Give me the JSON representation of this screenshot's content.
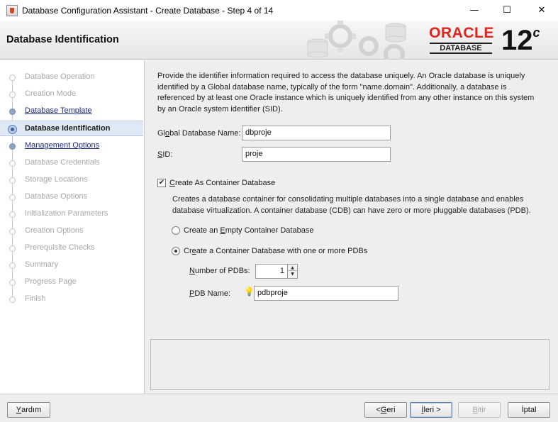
{
  "window": {
    "title": "Database Configuration Assistant - Create Database - Step 4 of 14",
    "controls": {
      "minimize": "—",
      "maximize": "☐",
      "close": "✕"
    }
  },
  "header": {
    "title": "Database Identification",
    "logo": {
      "word": "ORACLE",
      "registered": "®",
      "sub": "DATABASE",
      "version": "12",
      "version_suffix": "c"
    }
  },
  "nav": {
    "items": [
      {
        "label": "Database Operation",
        "state": "disabled"
      },
      {
        "label": "Creation Mode",
        "state": "disabled"
      },
      {
        "label": "Database Template",
        "state": "link"
      },
      {
        "label": "Database Identification",
        "state": "current"
      },
      {
        "label": "Management Options",
        "state": "link"
      },
      {
        "label": "Database Credentials",
        "state": "disabled"
      },
      {
        "label": "Storage Locations",
        "state": "disabled"
      },
      {
        "label": "Database Options",
        "state": "disabled"
      },
      {
        "label": "Initialization Parameters",
        "state": "disabled"
      },
      {
        "label": "Creation Options",
        "state": "disabled"
      },
      {
        "label": "Prerequisite Checks",
        "state": "disabled"
      },
      {
        "label": "Summary",
        "state": "disabled"
      },
      {
        "label": "Progress Page",
        "state": "disabled"
      },
      {
        "label": "Finish",
        "state": "disabled"
      }
    ]
  },
  "form": {
    "description": "Provide the identifier information required to access the database uniquely. An Oracle database is uniquely identified by a Global database name, typically of the form \"name.domain\". Additionally, a database is referenced by at least one Oracle instance which is uniquely identified from any other instance on this system by an Oracle system identifier (SID).",
    "global_db_name": {
      "label_pre": "Gl",
      "label_key": "o",
      "label_post": "bal Database Name:",
      "value": "dbproje"
    },
    "sid": {
      "label_key": "S",
      "label_post": "ID:",
      "value": "proje"
    },
    "container": {
      "checked": true,
      "label_key": "C",
      "label_post": "reate As Container Database",
      "description": "Creates a database container for consolidating multiple databases into a single database and enables database virtualization. A container database (CDB) can have zero or more pluggable databases (PDB).",
      "option_empty": {
        "label_pre": "Create an ",
        "label_key": "E",
        "label_post": "mpty Container Database",
        "selected": false
      },
      "option_pdbs": {
        "label_pre": "Cr",
        "label_key": "e",
        "label_post": "ate a Container Database with one or more PDBs",
        "selected": true
      },
      "num_pdbs": {
        "label_key": "N",
        "label_post": "umber of PDBs:",
        "value": "1"
      },
      "pdb_name": {
        "label_key": "P",
        "label_post": "DB Name:",
        "value": "pdbproje"
      }
    }
  },
  "footer": {
    "help": {
      "key": "Y",
      "rest": "ardım"
    },
    "back": {
      "pre": "< ",
      "key": "G",
      "rest": "eri"
    },
    "next": {
      "key": "İ",
      "rest": "leri >"
    },
    "finish": {
      "key": "B",
      "rest": "itir"
    },
    "cancel": {
      "label": "İptal"
    }
  }
}
